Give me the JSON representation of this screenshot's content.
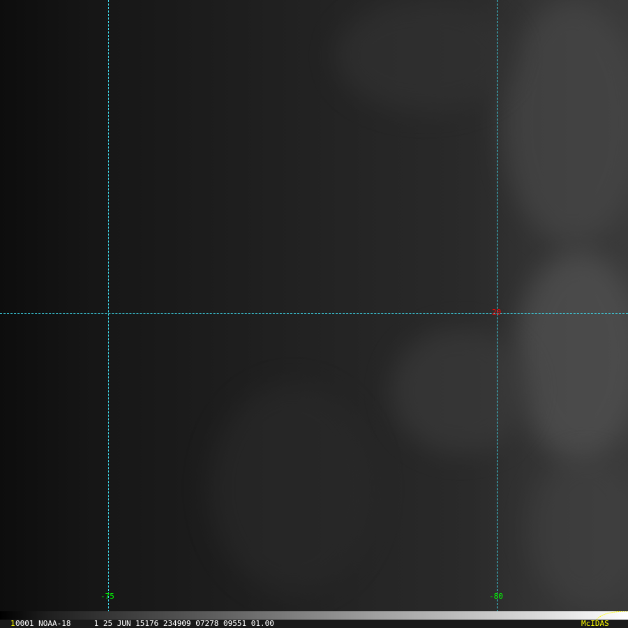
{
  "grid": {
    "line_color": "#3cd6e8",
    "longitude_labels": [
      "-75",
      "-80"
    ],
    "latitude_labels": [
      "20"
    ],
    "lon_label_color": "#00ff00",
    "lat_label_color": "#ff0000"
  },
  "status_bar": {
    "frame_number": "1",
    "info": "0001 NOAA-18     1 25 JUN 15176 234909 07278 09551 01.00",
    "brand": "McIDAS",
    "brand_color": "#ffff00"
  }
}
